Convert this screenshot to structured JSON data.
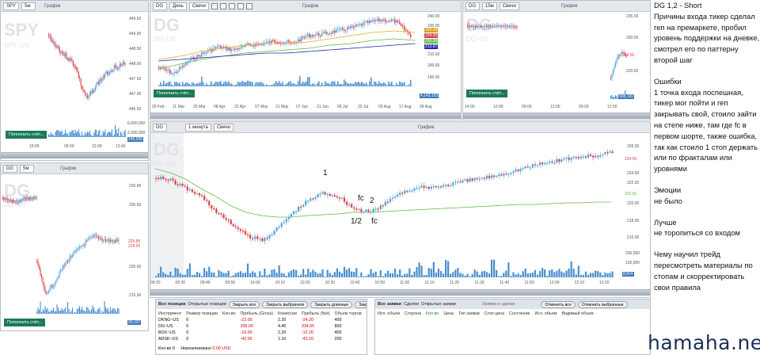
{
  "windows": {
    "spy": {
      "symbol": "SPY",
      "tf": "5м",
      "title": "График",
      "wm": "SPY",
      "wm2": "SPY~US",
      "prices": [
        "449.50",
        "449.00",
        "448.50",
        "448.00",
        "447.50",
        "447.00",
        "446.50"
      ],
      "vol": [
        "6,000,000",
        "4,000,000",
        "2,000,000"
      ],
      "vol_last": "146,936",
      "times": [
        "15:00",
        "09:00",
        "12:00",
        "13:00"
      ],
      "place": "Пополнить счёт..."
    },
    "daily": {
      "symbol": "DG",
      "tf": "День",
      "type": "Свечи",
      "title": "График",
      "wm": "DG",
      "wm2": "DG~US",
      "prices": [
        "240.00",
        "230.00",
        "220.00",
        "210.00",
        "200.00",
        "190.00",
        "180.00"
      ],
      "plabels": [
        "229.59",
        "224.55",
        "220.00",
        "213.87",
        "210.00"
      ],
      "vol_last": "4,143,193",
      "dates": [
        "25 Feb",
        "11 Mar",
        "25 Mar",
        "08 Apr",
        "22 Apr",
        "07 May",
        "21 May",
        "07 Jun",
        "21 Jun",
        "06 Jul",
        "20 Jul",
        "03 Aug",
        "17 Aug",
        "28 Aug"
      ],
      "place": "Пополнить счёт..."
    },
    "m15": {
      "symbol": "DG",
      "tf": "15м",
      "type": "Свечи",
      "title": "График",
      "wm": "DG",
      "wm2": "DG~US",
      "prices": [
        "235.00",
        "230.00",
        "225.00",
        "220.00"
      ],
      "plabel": "224.55",
      "vol_last": "908,100",
      "times": [
        "14:00",
        "12:00",
        "09:00",
        "12:00",
        "09:00",
        "12:00"
      ],
      "place": "Пополнить счёт..."
    },
    "m5": {
      "symbol": "DG",
      "tf": "5м",
      "title": "График",
      "wm": "DG",
      "wm2": "DG~US",
      "prices": [
        "235.00",
        "230.00",
        "225.00",
        "220.00",
        "215.00"
      ],
      "plabels": [
        "225.85",
        "224.55"
      ],
      "vol": [
        "200,000",
        "100,000"
      ],
      "vol_last": "90,107",
      "times": [
        "10:00",
        "12:00",
        "13:00"
      ],
      "place": "Пополнить счёт..."
    },
    "m1": {
      "symbol": "DG",
      "tf": "1 минута",
      "type": "Свечи",
      "title": "График",
      "wm": "DG",
      "wm2": "DG~US",
      "prices": [
        "226.00",
        "224.00",
        "222.00",
        "220.00",
        "218.00",
        "216.00"
      ],
      "plabels": [
        "224.55",
        "220.65"
      ],
      "vol": [
        "200,000",
        "100,000"
      ],
      "vol_last": "8,824",
      "times": [
        "09:20",
        "09:30",
        "09:40",
        "09:50",
        "10:00",
        "10:10",
        "10:20",
        "10:30",
        "10:40",
        "10:50",
        "11:00",
        "11:10",
        "11:20",
        "11:30",
        "11:40",
        "11:50",
        "12:00",
        "12:10",
        "12:20"
      ],
      "annotations": [
        "1",
        "fc",
        "2",
        "1/2",
        "fc"
      ]
    }
  },
  "positions": {
    "tabs": [
      "Все позиции",
      "Открытые позиции"
    ],
    "buttons": [
      "Закрыть все",
      "Закрыть выбранное",
      "Закрыть длинные",
      "Закр"
    ],
    "headers": [
      "Инструмент",
      "Размер позиции",
      "Кол-во",
      "Прибыль (Gross)",
      "Комиссии",
      "Прибыль (Net)",
      "Объем торгов"
    ],
    "rows": [
      [
        "DKNG~US",
        "0",
        "",
        "-22.00",
        "2.20",
        "-24.20",
        "400"
      ],
      [
        "DG~US",
        "0",
        "",
        "339.00",
        "4.40",
        "334.60",
        "800"
      ],
      [
        "BOX~US",
        "0",
        "",
        "-10.00",
        "2.20",
        "-12.20",
        "400"
      ],
      [
        "ADSK~US",
        "0",
        "",
        "-42.00",
        "1.10",
        "-43.10",
        "200"
      ]
    ],
    "footer_label": "Кол-во",
    "footer_count": "0",
    "footer_unreal": "Нереализовано",
    "footer_unreal_val": "0.00 USD"
  },
  "orders": {
    "title": "Заявки и сделки",
    "tabs": [
      "Все заявки",
      "Сделки",
      "Открытые заявки"
    ],
    "buttons": [
      "Отменить все",
      "Отменить выбранные"
    ],
    "headers": [
      "Исп. объем",
      "Сторона",
      "Кол-во",
      "Цена",
      "Тип заявки",
      "Стоп цена",
      "Состояние",
      "Исп. объем",
      "Видимый объем"
    ]
  },
  "notes": {
    "title": "DG 1,2 - Short",
    "lines1": "Причины входа тикер сделал геп на премаркете, пробил уровень поддержки на дневке, смотрел его по паттерну второй шаг",
    "h2": "Ошибки",
    "lines2": "1 точка входа поспешная, тикер мог пойти и геп закрывать свой, стоило зайти на степе ниже,  там где fc в первом шорте, также ошибка, так как стоило 1 стоп держать или по фракталам или уровнями",
    "h3": "Эмоции",
    "l3": "не было",
    "h4": "Лучше",
    "l4": "не торопиться со входом",
    "h5": "Чему научил трейд",
    "l5": "пересмотреть материалы по стопам и скорректировать свои правила"
  },
  "watermark": "hamaha.net",
  "colors": {
    "up": "#4aa3df",
    "down": "#d9414a",
    "ma_green": "#6bb84c",
    "ma_yellow": "#e0b020",
    "ma_blue": "#1b2fb0",
    "place": "#1b7a55"
  }
}
